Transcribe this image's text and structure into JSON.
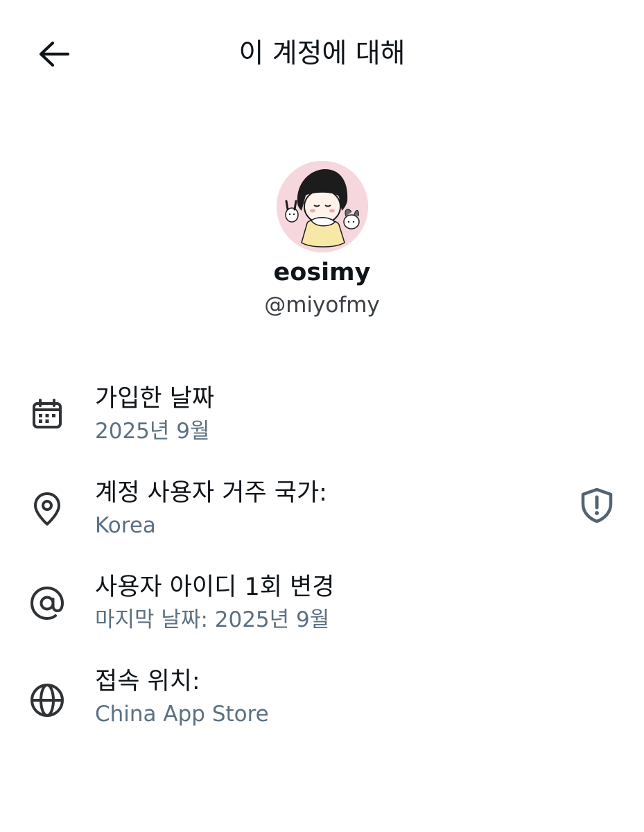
{
  "header": {
    "title": "이 계정에 대해",
    "back_icon": "arrow-left-icon"
  },
  "profile": {
    "display_name": "eosimy",
    "handle": "@miyofmy",
    "avatar_bg": "#f7d7de"
  },
  "info": [
    {
      "icon": "calendar-icon",
      "label": "가입한 날짜",
      "value": "2025년 9월"
    },
    {
      "icon": "location-pin-icon",
      "label": "계정 사용자 거주 국가:",
      "value": "Korea",
      "action_icon": "shield-alert-icon"
    },
    {
      "icon": "at-sign-icon",
      "label": "사용자 아이디 1회 변경",
      "value": "마지막 날짜: 2025년 9월"
    },
    {
      "icon": "globe-icon",
      "label": "접속 위치:",
      "value": "China App Store"
    }
  ],
  "colors": {
    "text_primary": "#0f1419",
    "text_secondary": "#5b7083",
    "icon": "#2f3336",
    "shield": "#536471"
  }
}
